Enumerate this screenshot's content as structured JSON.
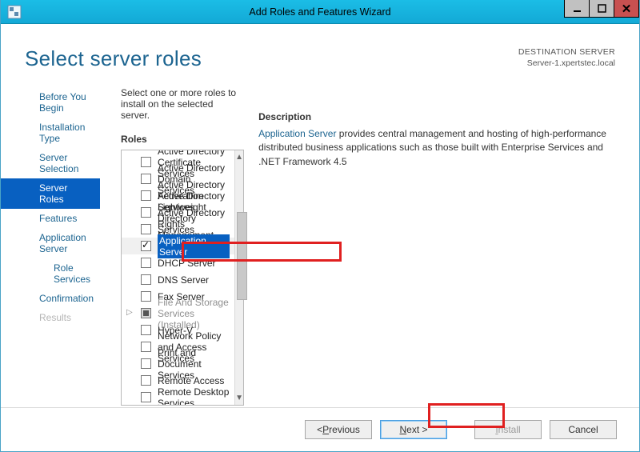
{
  "window": {
    "title": "Add Roles and Features Wizard"
  },
  "header": {
    "page_title": "Select server roles",
    "dest_label": "DESTINATION SERVER",
    "dest_value": "Server-1.xpertstec.local"
  },
  "intro": "Select one or more roles to install on the selected server.",
  "labels": {
    "roles": "Roles",
    "description": "Description"
  },
  "sidebar": {
    "items": [
      {
        "label": "Before You Begin"
      },
      {
        "label": "Installation Type"
      },
      {
        "label": "Server Selection"
      },
      {
        "label": "Server Roles"
      },
      {
        "label": "Features"
      },
      {
        "label": "Application Server"
      },
      {
        "label": "Role Services"
      },
      {
        "label": "Confirmation"
      },
      {
        "label": "Results"
      }
    ]
  },
  "roles": [
    {
      "label": "Active Directory Certificate Services"
    },
    {
      "label": "Active Directory Domain Services"
    },
    {
      "label": "Active Directory Federation Services"
    },
    {
      "label": "Active Directory Lightweight Directory Services"
    },
    {
      "label": "Active Directory Rights Management Services"
    },
    {
      "label": "Application Server"
    },
    {
      "label": "DHCP Server"
    },
    {
      "label": "DNS Server"
    },
    {
      "label": "Fax Server"
    },
    {
      "label": "File And Storage Services (Installed)"
    },
    {
      "label": "Hyper-V"
    },
    {
      "label": "Network Policy and Access Services"
    },
    {
      "label": "Print and Document Services"
    },
    {
      "label": "Remote Access"
    },
    {
      "label": "Remote Desktop Services"
    }
  ],
  "description": {
    "link": "Application Server",
    "text": " provides central management and hosting of high-performance distributed business applications such as those built with Enterprise Services and .NET Framework 4.5"
  },
  "buttons": {
    "previous": "Previous",
    "next": "ext >",
    "next_prefix": "N",
    "install": "nstall",
    "install_prefix": "I",
    "cancel": "Cancel",
    "prev_prefix": "< "
  }
}
